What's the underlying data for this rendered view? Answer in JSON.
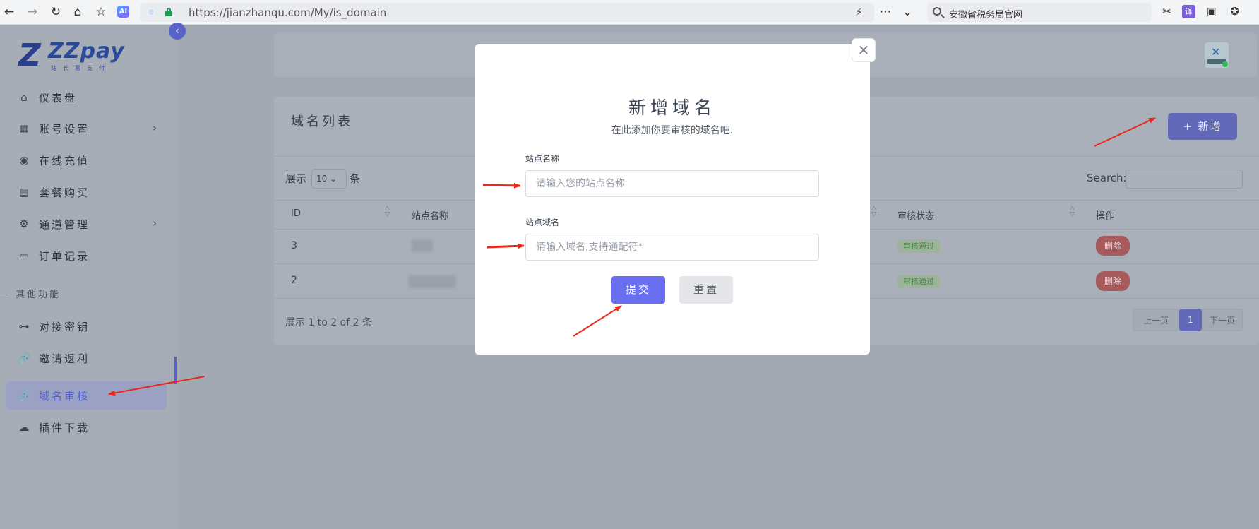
{
  "browser": {
    "url": "https://jianzhanqu.com/My/is_domain",
    "ai_badge": "AI",
    "search_text": "安徽省税务局官网"
  },
  "sidebar": {
    "logo": {
      "mark": "Z",
      "name": "ZZpay",
      "sub": "站长易支付"
    },
    "items": [
      {
        "label": "仪表盘",
        "icon": "home-icon"
      },
      {
        "label": "账号设置",
        "icon": "account-icon",
        "has_children": true
      },
      {
        "label": "在线充值",
        "icon": "camera-icon"
      },
      {
        "label": "套餐购买",
        "icon": "bag-icon"
      },
      {
        "label": "通道管理",
        "icon": "gear-icon",
        "has_children": true
      },
      {
        "label": "订单记录",
        "icon": "wallet-icon"
      }
    ],
    "section": "其他功能",
    "items2": [
      {
        "label": "对接密钥",
        "icon": "key-icon"
      },
      {
        "label": "邀请返利",
        "icon": "link-icon"
      },
      {
        "label": "域名审核",
        "icon": "link-icon",
        "active": true
      },
      {
        "label": "插件下载",
        "icon": "cloud-download-icon"
      }
    ]
  },
  "card": {
    "title": "域名列表",
    "add_button": "+ 新增",
    "show_label": "展示",
    "page_size": "10",
    "show_unit": "条",
    "search_label": "Search:",
    "columns": [
      "ID",
      "站点名称",
      "审核状态",
      "操作"
    ],
    "rows": [
      {
        "id": "3",
        "status": "审核通过",
        "action": "删除"
      },
      {
        "id": "2",
        "status": "审核通过",
        "action": "删除"
      }
    ],
    "info": "展示 1 to 2 of 2 条",
    "pagination": {
      "prev": "上一页",
      "current": "1",
      "next": "下一页"
    }
  },
  "modal": {
    "title": "新增域名",
    "subtitle": "在此添加你要审核的域名吧.",
    "field1_label": "站点名称",
    "field1_placeholder": "请输入您的站点名称",
    "field2_label": "站点域名",
    "field2_placeholder": "请输入域名,支持通配符*",
    "submit": "提交",
    "reset": "重置"
  },
  "colors": {
    "accent": "#6a6ff2",
    "annotation": "#e8281c",
    "status_green": "#4f8a4c",
    "delete_red": "#a65a5c"
  }
}
